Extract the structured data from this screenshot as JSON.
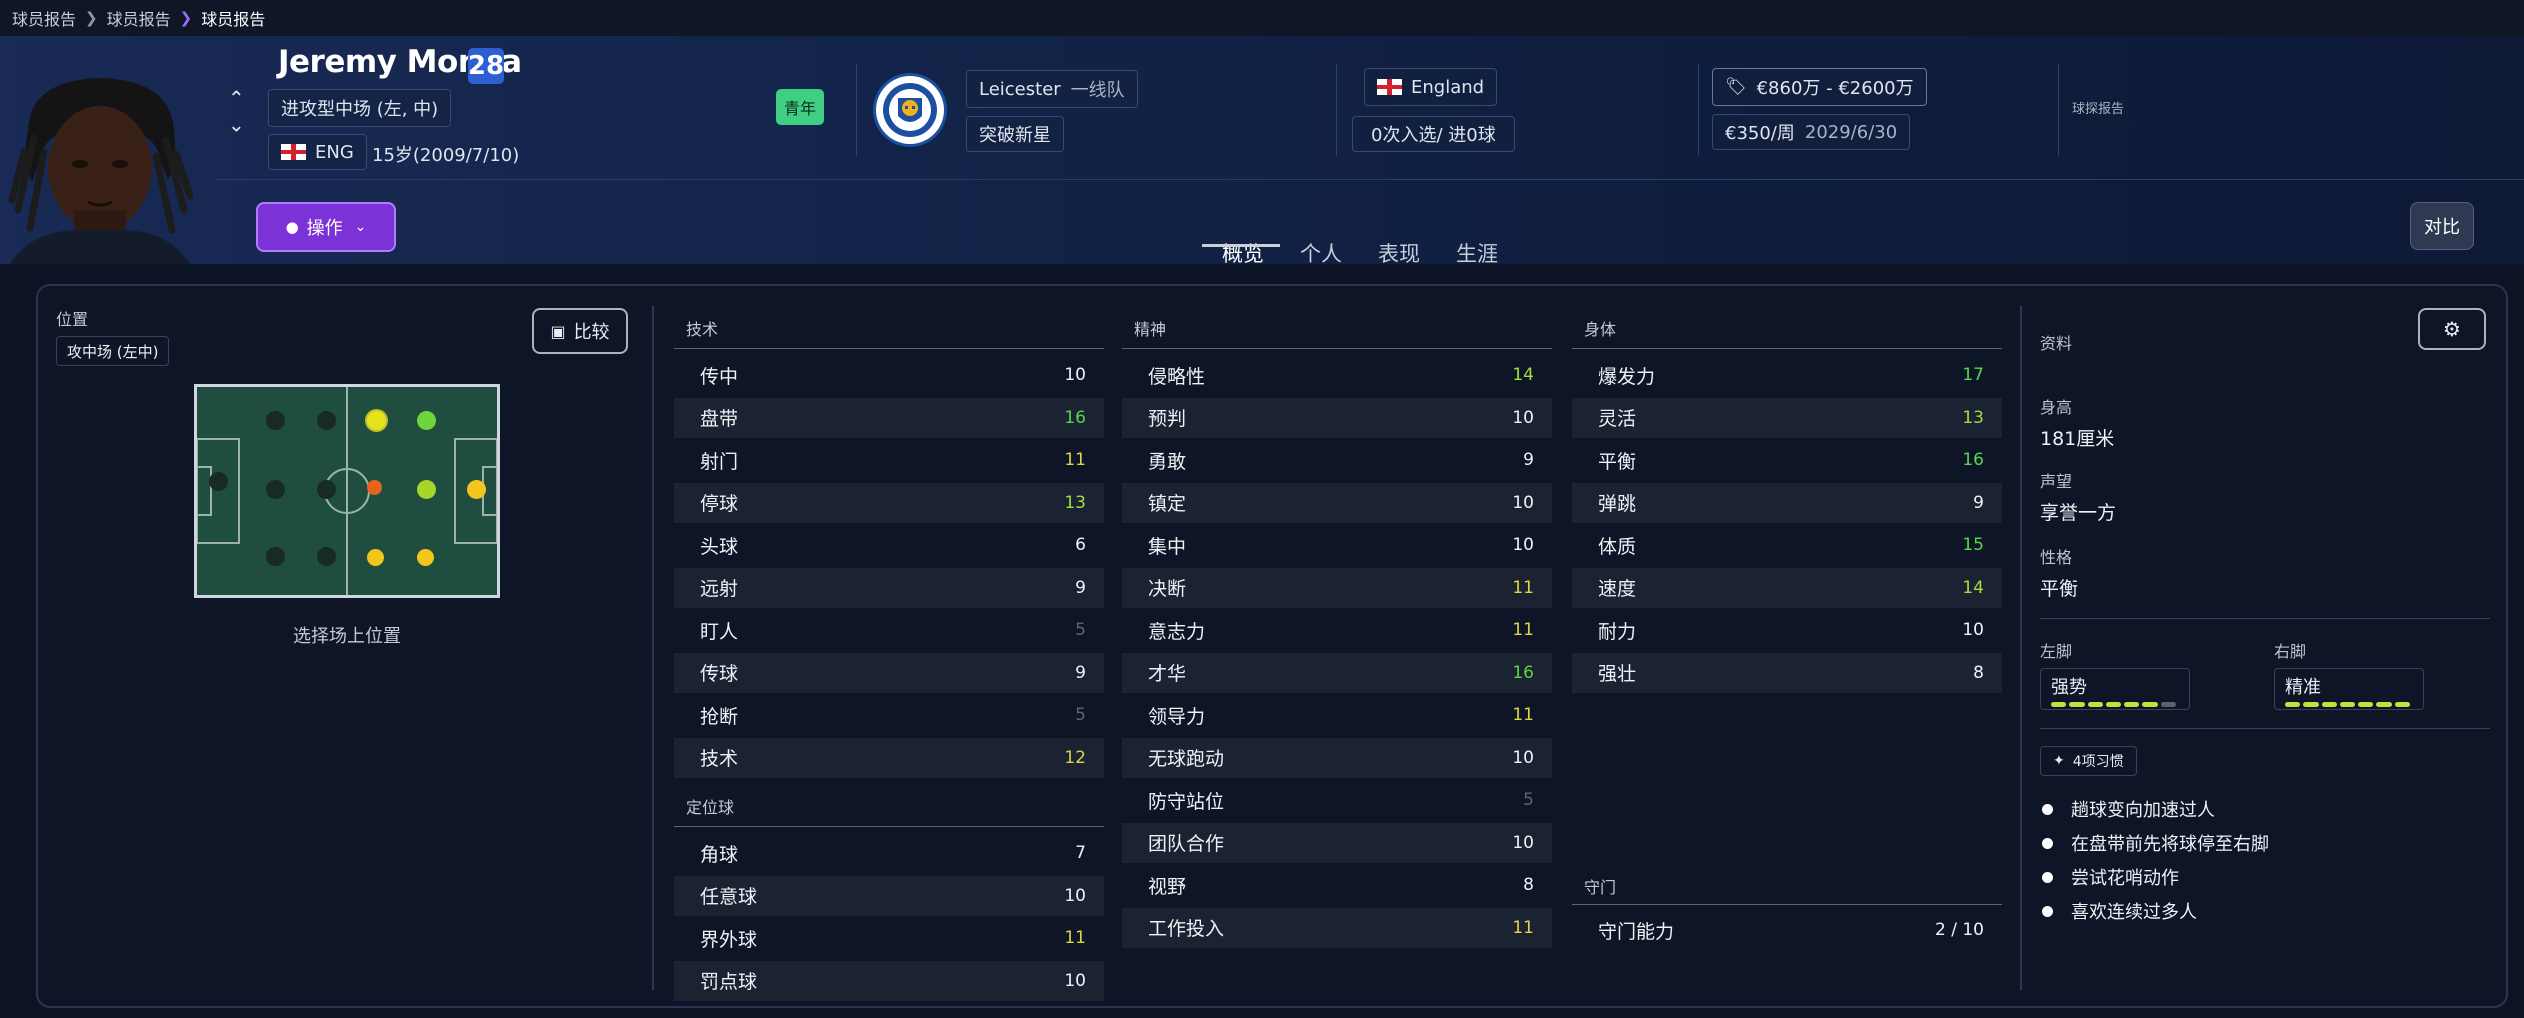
{
  "breadcrumb": [
    "球员报告",
    "球员报告",
    "球员报告"
  ],
  "player": {
    "name": "Jeremy Monga",
    "number": "28",
    "position": "进攻型中场 (左, 中)",
    "nationality_code": "ENG",
    "age_dob": "15岁(2009/7/10)",
    "tag": "青年",
    "club": "Leicester",
    "squad": "一线队",
    "status": "突破新星",
    "country": "England",
    "caps": "0次入选/ 进0球",
    "value": "€860万 - €2600万",
    "wage": "€350/周",
    "contract": "2029/6/30",
    "scout_report": "球探报告"
  },
  "actions": {
    "operate": "操作",
    "compare_player": "对比",
    "compare": "比较"
  },
  "tabs": [
    {
      "label": "概览",
      "active": true
    },
    {
      "label": "个人",
      "active": false
    },
    {
      "label": "表现",
      "active": false
    },
    {
      "label": "生涯",
      "active": false
    }
  ],
  "position_panel": {
    "title": "位置",
    "selected": "攻中场 (左中)",
    "hint": "选择场上位置"
  },
  "technical": {
    "title": "技术",
    "attrs": [
      {
        "name": "传中",
        "value": "10"
      },
      {
        "name": "盘带",
        "value": "16"
      },
      {
        "name": "射门",
        "value": "11"
      },
      {
        "name": "停球",
        "value": "13"
      },
      {
        "name": "头球",
        "value": "6"
      },
      {
        "name": "远射",
        "value": "9"
      },
      {
        "name": "盯人",
        "value": "5"
      },
      {
        "name": "传球",
        "value": "9"
      },
      {
        "name": "抢断",
        "value": "5"
      },
      {
        "name": "技术",
        "value": "12"
      }
    ]
  },
  "set_pieces": {
    "title": "定位球",
    "attrs": [
      {
        "name": "角球",
        "value": "7"
      },
      {
        "name": "任意球",
        "value": "10"
      },
      {
        "name": "界外球",
        "value": "11"
      },
      {
        "name": "罚点球",
        "value": "10"
      }
    ]
  },
  "mental": {
    "title": "精神",
    "attrs": [
      {
        "name": "侵略性",
        "value": "14"
      },
      {
        "name": "预判",
        "value": "10"
      },
      {
        "name": "勇敢",
        "value": "9"
      },
      {
        "name": "镇定",
        "value": "10"
      },
      {
        "name": "集中",
        "value": "10"
      },
      {
        "name": "决断",
        "value": "11"
      },
      {
        "name": "意志力",
        "value": "11"
      },
      {
        "name": "才华",
        "value": "16"
      },
      {
        "name": "领导力",
        "value": "11"
      },
      {
        "name": "无球跑动",
        "value": "10"
      },
      {
        "name": "防守站位",
        "value": "5"
      },
      {
        "name": "团队合作",
        "value": "10"
      },
      {
        "name": "视野",
        "value": "8"
      },
      {
        "name": "工作投入",
        "value": "11"
      }
    ]
  },
  "physical": {
    "title": "身体",
    "attrs": [
      {
        "name": "爆发力",
        "value": "17"
      },
      {
        "name": "灵活",
        "value": "13"
      },
      {
        "name": "平衡",
        "value": "16"
      },
      {
        "name": "弹跳",
        "value": "9"
      },
      {
        "name": "体质",
        "value": "15"
      },
      {
        "name": "速度",
        "value": "14"
      },
      {
        "name": "耐力",
        "value": "10"
      },
      {
        "name": "强壮",
        "value": "8"
      }
    ]
  },
  "goalkeeping": {
    "title": "守门",
    "attrs": [
      {
        "name": "守门能力",
        "value": "2 / 10"
      }
    ]
  },
  "info": {
    "title": "资料",
    "height_label": "身高",
    "height": "181厘米",
    "reputation_label": "声望",
    "reputation": "享誉一方",
    "personality_label": "性格",
    "personality": "平衡",
    "left_foot_label": "左脚",
    "left_foot": "强势",
    "left_foot_level": 6,
    "right_foot_label": "右脚",
    "right_foot": "精准",
    "right_foot_level": 7,
    "foot_level_max": 7,
    "traits_button": "4项习惯",
    "traits": [
      "趟球变向加速过人",
      "在盘带前先将球停至右脚",
      "尝试花哨动作",
      "喜欢连续过多人"
    ]
  },
  "colors": {
    "attr_high": "#56d84a",
    "attr_good": "#a6dc3e",
    "attr_mid": "#e2d34a",
    "attr_low": "#5d6574",
    "youth_badge": "#3fcf83",
    "operate_button": "#7b32d6",
    "pitch": "#1f4d40"
  }
}
